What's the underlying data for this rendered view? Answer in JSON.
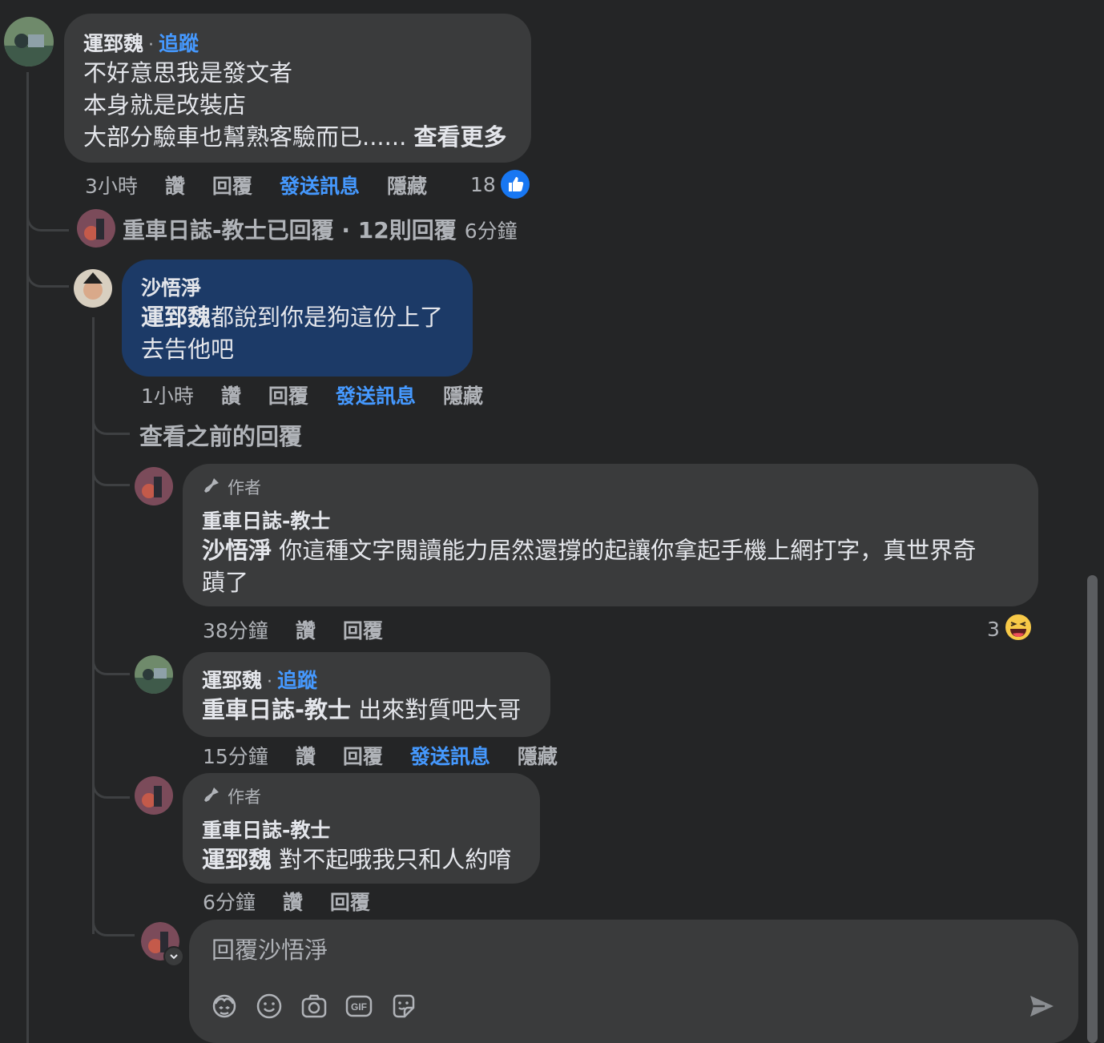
{
  "comment1": {
    "author": "運郅魏",
    "follow_label": "追蹤",
    "lines": [
      "不好意思我是發文者",
      "本身就是改裝店",
      "大部分驗車也幫熟客驗而已......"
    ],
    "see_more": "查看更多",
    "time": "3小時",
    "like": "讚",
    "reply": "回覆",
    "message": "發送訊息",
    "hide": "隱藏",
    "reaction_count": "18"
  },
  "replied_summary": {
    "text": "重車日誌-教士已回覆 · 12則回覆",
    "time": "6分鐘"
  },
  "comment2": {
    "author": "沙悟淨",
    "mention": "運郅魏",
    "line1_rest": "都說到你是狗這份上了",
    "line2": "去告他吧",
    "time": "1小時",
    "like": "讚",
    "reply": "回覆",
    "message": "發送訊息",
    "hide": "隱藏"
  },
  "view_previous": "查看之前的回覆",
  "comment3": {
    "author_tag": "作者",
    "author": "重車日誌-教士",
    "mention": "沙悟淨",
    "line1_rest": " 你這種文字閱讀能力居然還撐的起讓你拿起手機上網打字，真世界奇",
    "line2": "蹟了",
    "time": "38分鐘",
    "like": "讚",
    "reply": "回覆",
    "reaction_count": "3"
  },
  "comment4": {
    "author": "運郅魏",
    "follow_label": "追蹤",
    "mention": "重車日誌-教士",
    "text_rest": " 出來對質吧大哥",
    "time": "15分鐘",
    "like": "讚",
    "reply": "回覆",
    "message": "發送訊息",
    "hide": "隱藏"
  },
  "comment5": {
    "author_tag": "作者",
    "author": "重車日誌-教士",
    "mention": "運郅魏",
    "text_rest": " 對不起哦我只和人約唷",
    "time": "6分鐘",
    "like": "讚",
    "reply": "回覆"
  },
  "composer": {
    "placeholder": "回覆沙悟淨",
    "icons": [
      "avatar-sticker-icon",
      "emoji-icon",
      "camera-icon",
      "gif-icon",
      "sticker-icon",
      "send-icon"
    ]
  },
  "colors": {
    "background": "#242526",
    "bubble": "#3a3b3c",
    "bubble_highlight": "#1c3a67",
    "link": "#4599ff",
    "secondary_text": "#b0b3b8"
  }
}
